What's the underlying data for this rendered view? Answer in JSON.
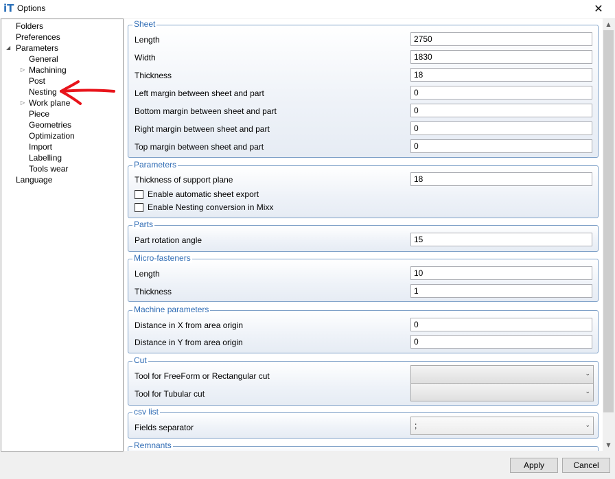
{
  "window": {
    "title": "Options",
    "close_glyph": "✕",
    "app_icon_text": "iT"
  },
  "tree": {
    "items": [
      {
        "label": "Folders"
      },
      {
        "label": "Preferences"
      },
      {
        "label": "Parameters"
      },
      {
        "label": "General"
      },
      {
        "label": "Machining"
      },
      {
        "label": "Post"
      },
      {
        "label": "Nesting"
      },
      {
        "label": "Work plane"
      },
      {
        "label": "Piece"
      },
      {
        "label": "Geometries"
      },
      {
        "label": "Optimization"
      },
      {
        "label": "Import"
      },
      {
        "label": "Labelling"
      },
      {
        "label": "Tools wear"
      },
      {
        "label": "Language"
      }
    ]
  },
  "groups": {
    "sheet": {
      "title": "Sheet",
      "rows": [
        {
          "label": "Length",
          "value": "2750"
        },
        {
          "label": "Width",
          "value": "1830"
        },
        {
          "label": "Thickness",
          "value": "18"
        },
        {
          "label": "Left margin between sheet and part",
          "value": "0"
        },
        {
          "label": "Bottom margin between sheet and part",
          "value": "0"
        },
        {
          "label": "Right margin between sheet and part",
          "value": "0"
        },
        {
          "label": "Top margin between sheet and part",
          "value": "0"
        }
      ]
    },
    "parameters": {
      "title": "Parameters",
      "support_label": "Thickness of support plane",
      "support_value": "18",
      "check1": "Enable automatic sheet export",
      "check2": "Enable Nesting conversion in Mixx"
    },
    "parts": {
      "title": "Parts",
      "label": "Part rotation angle",
      "value": "15"
    },
    "micro": {
      "title": "Micro-fasteners",
      "rows": [
        {
          "label": "Length",
          "value": "10"
        },
        {
          "label": "Thickness",
          "value": "1"
        }
      ]
    },
    "machine": {
      "title": "Machine parameters",
      "rows": [
        {
          "label": "Distance in X from area origin",
          "value": "0"
        },
        {
          "label": "Distance in Y from area origin",
          "value": "0"
        }
      ]
    },
    "cut": {
      "title": "Cut",
      "row1": "Tool for FreeForm or Rectangular cut",
      "row2": "Tool for Tubular cut",
      "value1": "",
      "value2": ""
    },
    "csv": {
      "title": "csv list",
      "label": "Fields separator",
      "value": ";"
    },
    "remnants": {
      "title": "Remnants"
    }
  },
  "buttons": {
    "apply": "Apply",
    "cancel": "Cancel"
  },
  "colors": {
    "accent": "#2e6bb4",
    "arrow": "#e8141b"
  }
}
